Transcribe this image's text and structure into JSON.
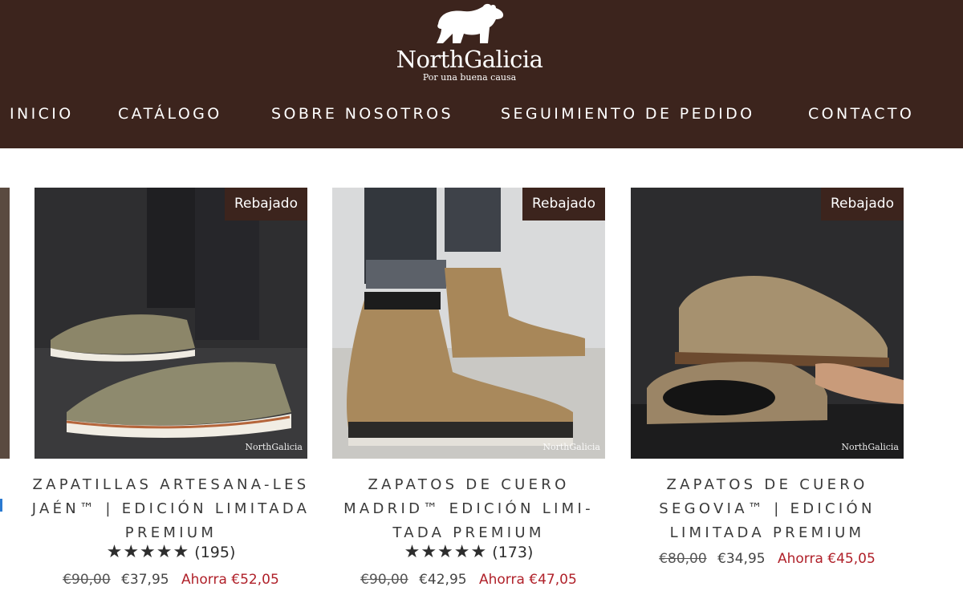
{
  "brand": {
    "name": "NorthGalicia",
    "tagline": "Por una buena causa"
  },
  "nav": {
    "items": [
      "INICIO",
      "CATÁLOGO",
      "SOBRE NOSOTROS",
      "SEGUIMIENTO DE PEDIDO",
      "CONTACTO"
    ]
  },
  "products": [
    {
      "badge": "Rebajado",
      "watermark": "NorthGalicia",
      "title": "ZAPATILLAS ARTESANA-LES JAÉN™ | EDICIÓN LIMITADA PREMIUM",
      "stars": "★★★★★",
      "reviews": "(195)",
      "old_price": "€90,00",
      "price": "€37,95",
      "savings": "Ahorra €52,05"
    },
    {
      "badge": "Rebajado",
      "watermark": "NorthGalicia",
      "title": "ZAPATOS DE CUERO MADRID™ EDICIÓN LIMI-TADA PREMIUM",
      "stars": "★★★★★",
      "reviews": "(173)",
      "old_price": "€90,00",
      "price": "€42,95",
      "savings": "Ahorra €47,05"
    },
    {
      "badge": "Rebajado",
      "watermark": "NorthGalicia",
      "title": "ZAPATOS DE CUERO SEGOVIA™ | EDICIÓN LIMITADA PREMIUM",
      "old_price": "€80,00",
      "price": "€34,95",
      "savings": "Ahorra €45,05"
    }
  ],
  "colors": {
    "header_bg": "#3c241d",
    "badge_bg": "#3c241d",
    "savings_text": "#b0212a"
  },
  "icons": [
    "bear-logo-icon",
    "star-icon"
  ]
}
